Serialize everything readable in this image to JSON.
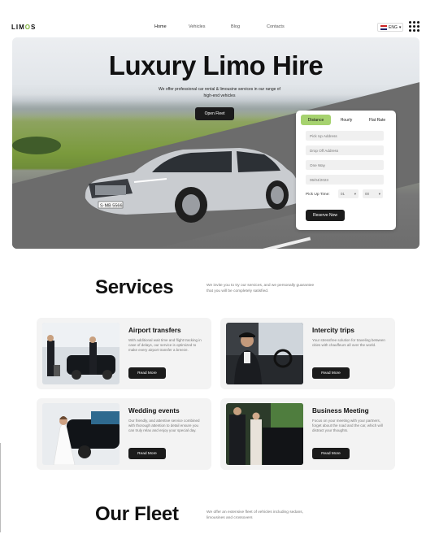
{
  "header": {
    "logo_left": "LIM",
    "logo_o": "O",
    "logo_right": "S",
    "nav": [
      "Home",
      "Vehicles",
      "Blog",
      "Contacts"
    ],
    "language": "ENG",
    "menu_icon": "grid-menu-icon"
  },
  "hero": {
    "title": "Luxury Limo Hire",
    "subtitle": "We offer professional car rental & limousine services in our range of high-end vehicles",
    "open_fleet_label": "Open Fleet",
    "plate": "S·MB 5566"
  },
  "booking": {
    "tabs": [
      "Distance",
      "Hourly",
      "Flat Rate"
    ],
    "active_tab": "Distance",
    "pickup_placeholder": "Pick Up Address",
    "dropoff_placeholder": "Drop Off Address",
    "trip_type": "One Way",
    "date": "06/04/2023",
    "pickup_time_label": "Pick Up Time:",
    "hour": "01",
    "minute": "00",
    "reserve_label": "Reserve Now",
    "accent_color": "#a6d26f"
  },
  "services": {
    "title": "Services",
    "description": "We invite you to try our services, and we personally guarantee that you will be completely satisfied.",
    "cards": [
      {
        "title": "Airport transfers",
        "text": "With additional wait time and flight tracking in case of delays, our service is optimized to make every airport transfer a breeze.",
        "button": "Read More"
      },
      {
        "title": "Intercity trips",
        "text": "Your stressfree solution for traveling between cities with chauffeurs all over the world.",
        "button": "Read More"
      },
      {
        "title": "Wedding events",
        "text": "Our friendly, and attentive service combined with thorough attention to detail ensure you can truly relax and enjoy your special day.",
        "button": "Read More"
      },
      {
        "title": "Business Meeting",
        "text": "Focus on your meeting with your partners, forget about the road and the car, which will distract your thoughts.",
        "button": "Read More"
      }
    ]
  },
  "fleet": {
    "title": "Our Fleet",
    "description": "We offer an extensive fleet of vehicles including sedans, limousines and crossovers"
  }
}
